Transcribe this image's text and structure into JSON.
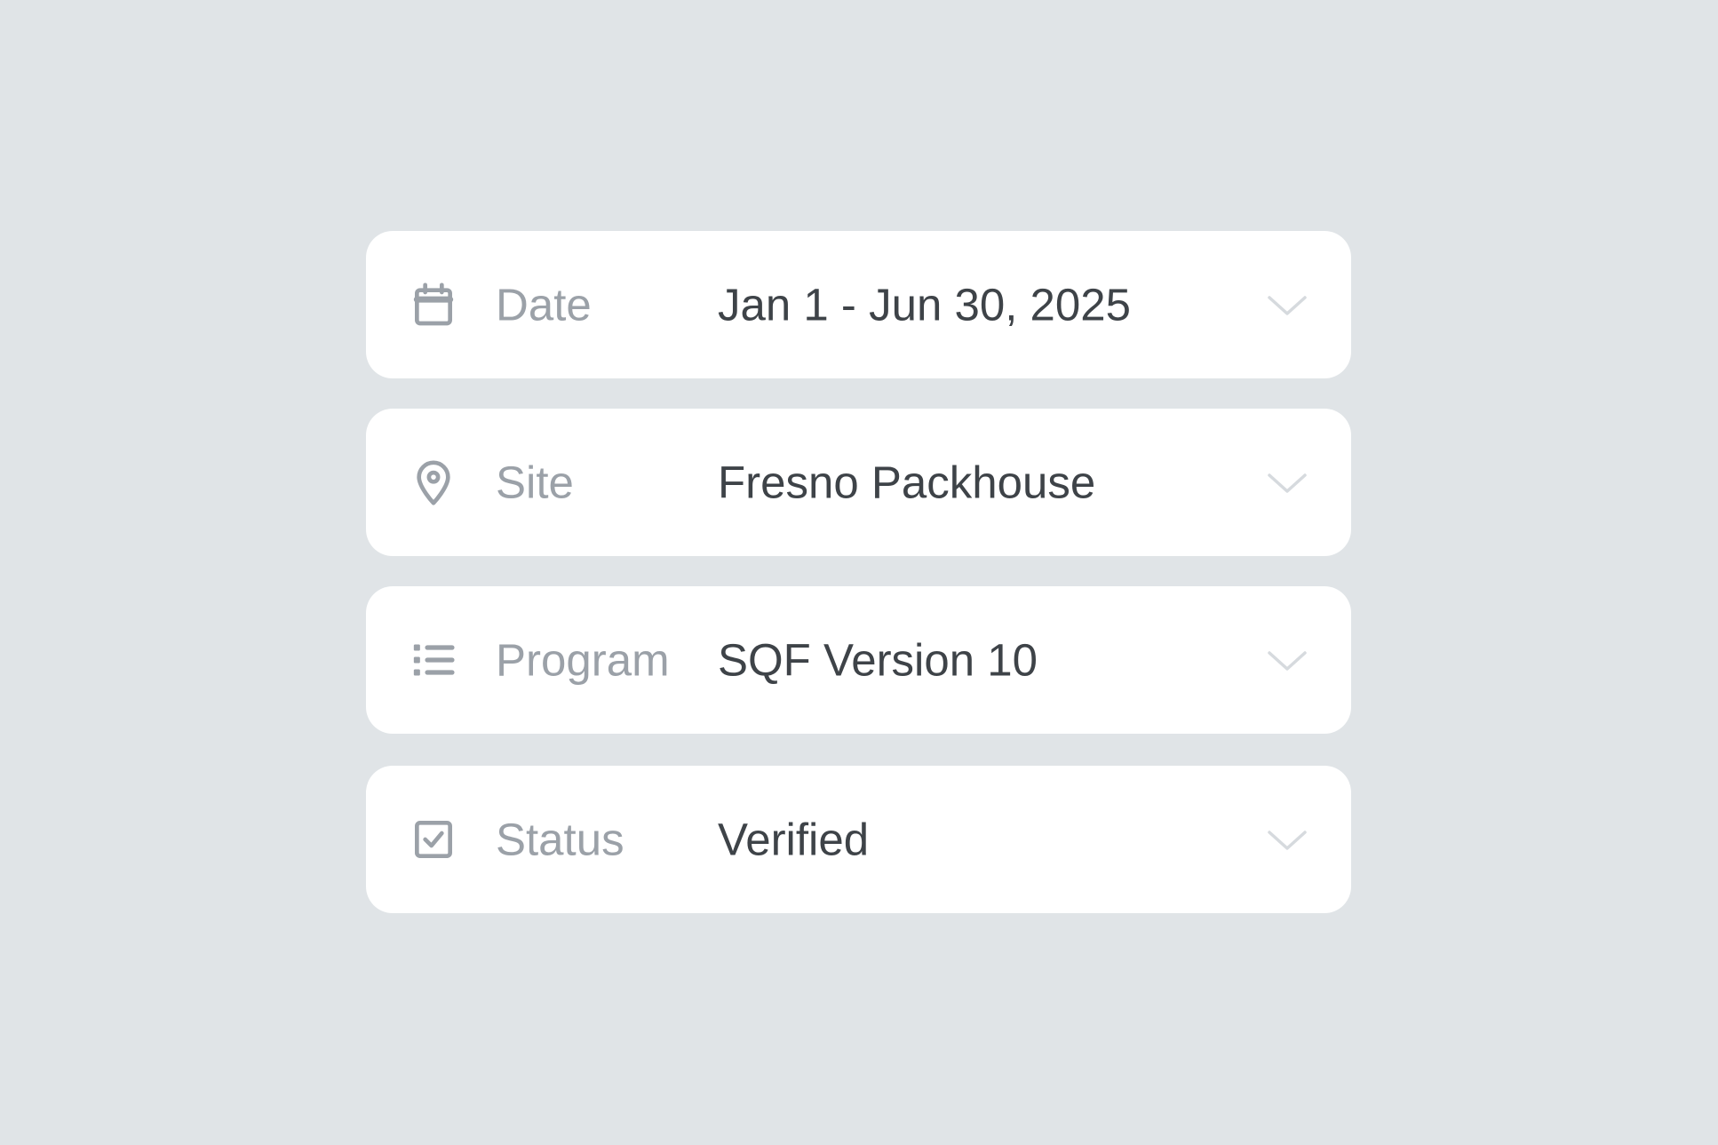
{
  "colors": {
    "background": "#e0e4e7",
    "card": "#ffffff",
    "icon": "#9ba1a8",
    "label": "#9ba1a8",
    "value": "#3e4348",
    "chevron": "#d6dade"
  },
  "filters": [
    {
      "icon": "calendar-icon",
      "label": "Date",
      "value": "Jan 1 - Jun 30, 2025"
    },
    {
      "icon": "map-pin-icon",
      "label": "Site",
      "value": "Fresno Packhouse"
    },
    {
      "icon": "list-icon",
      "label": "Program",
      "value": "SQF Version 10"
    },
    {
      "icon": "checkbox-icon",
      "label": "Status",
      "value": "Verified"
    }
  ]
}
